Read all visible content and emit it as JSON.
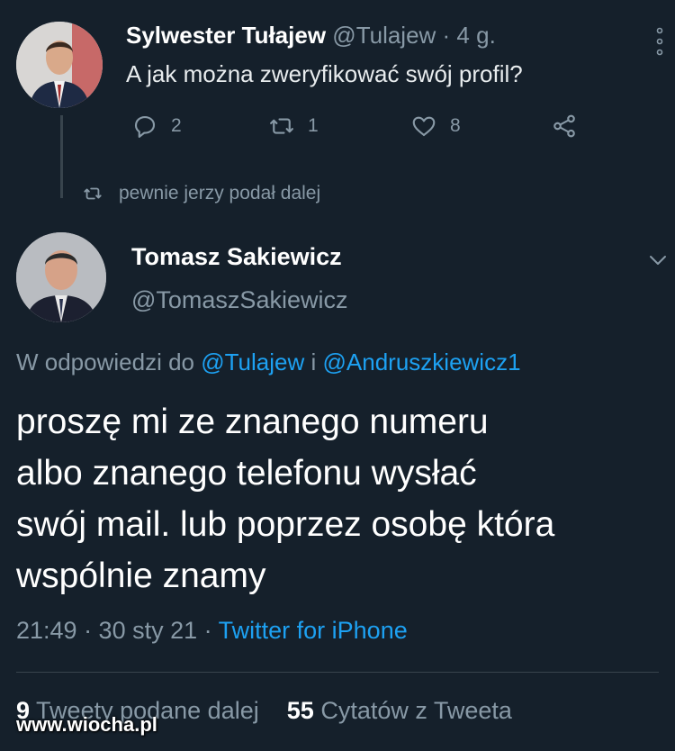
{
  "tweet1": {
    "name": "Sylwester Tułajew",
    "handle_time": "@Tulajew · 4 g.",
    "text": "A jak można zweryfikować swój profil?",
    "replies": "2",
    "retweets": "1",
    "likes": "8"
  },
  "retweet_note": "pewnie jerzy podał dalej",
  "tweet2": {
    "name": "Tomasz Sakiewicz",
    "handle": "@TomaszSakiewicz",
    "reply_prefix": "W odpowiedzi do",
    "reply_to_1": "@Tulajew",
    "reply_conj": "i",
    "reply_to_2": "@Andruszkiewicz1",
    "text_lines": [
      "proszę mi ze znanego numeru",
      "albo znanego telefonu wysłać",
      "swój mail. lub poprzez osobę która",
      "wspólnie znamy"
    ],
    "time_date": "21:49 · 30 sty 21 ·",
    "source": "Twitter for iPhone"
  },
  "stats": {
    "retweets_count": "9",
    "retweets_label": "Tweety podane dalej",
    "quotes_count": "55",
    "quotes_label": "Cytatów z Tweeta"
  },
  "watermark": "www.wiocha.pl",
  "colors": {
    "background": "#15202b",
    "link": "#1da1f2",
    "muted": "#8899a6"
  }
}
